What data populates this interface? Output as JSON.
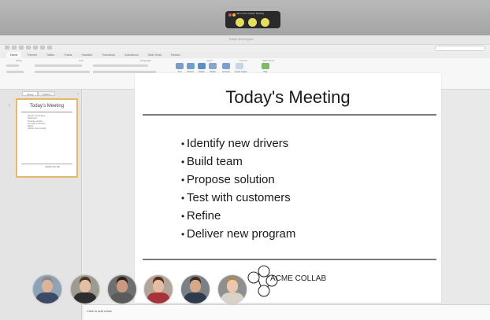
{
  "share_bar": {
    "label": "Jan Love's screen sharing",
    "dot_colors": [
      "#e05252",
      "#e7b83c"
    ],
    "participant_dots": 3
  },
  "app": {
    "title": "Todays Meeting.pptx",
    "tabs": [
      "Home",
      "Themes",
      "Tables",
      "Charts",
      "SmartArt",
      "Transitions",
      "Animations",
      "Slide Show",
      "Review"
    ],
    "active_tab": "Home",
    "ribbon_groups": [
      "Slides",
      "Font",
      "Paragraph",
      "Insert",
      "Format",
      "Slide Show"
    ],
    "ribbon_buttons": [
      "Text",
      "Picture",
      "Shape",
      "Media",
      "Arrange",
      "Quick Styles",
      "Play"
    ],
    "accent_color": "#e6b86a"
  },
  "thumbnail_pane": {
    "tabs": [
      "Slides",
      "Outline"
    ],
    "active_tab": "Slides",
    "slide_number": "1",
    "thumb": {
      "title": "Today's Meeting",
      "bullets": [
        "Identify new drivers",
        "Build team",
        "Propose solution",
        "Test with customers",
        "Refine",
        "Deliver new program"
      ],
      "logo_text": "ACME COLLAB"
    }
  },
  "slide": {
    "title": "Today's Meeting",
    "bullet_glyph": "•",
    "bullets": [
      "Identify new drivers",
      "Build team",
      "Propose solution",
      "Test with customers",
      "Refine",
      "Deliver new program"
    ],
    "logo_text": "ACME COLLAB"
  },
  "notes": {
    "placeholder": "Click to add notes"
  },
  "participants": [
    {
      "icon": "participant-1-avatar",
      "skin": "#d9b39a",
      "hair": "#8a8a8a",
      "shirt": "#3c4a66",
      "bg": "#8fa3b8"
    },
    {
      "icon": "participant-2-avatar",
      "skin": "#e2c0a4",
      "hair": "#4a3626",
      "shirt": "#2d2d2d",
      "bg": "#9d9a8f"
    },
    {
      "icon": "participant-3-avatar",
      "skin": "#c99a7f",
      "hair": "#2b2118",
      "shirt": "#5b5b5b",
      "bg": "#6f6f6f"
    },
    {
      "icon": "participant-4-avatar",
      "skin": "#e5bda3",
      "hair": "#5a2c1e",
      "shirt": "#a8323a",
      "bg": "#b2a69a"
    },
    {
      "icon": "participant-5-avatar",
      "skin": "#d6a88a",
      "hair": "#3d2b1f",
      "shirt": "#2f3b4a",
      "bg": "#7b7f86"
    },
    {
      "icon": "participant-6-avatar",
      "skin": "#ebc8ad",
      "hair": "#b08a54",
      "shirt": "#d9d3c7",
      "bg": "#8d8f90"
    }
  ]
}
